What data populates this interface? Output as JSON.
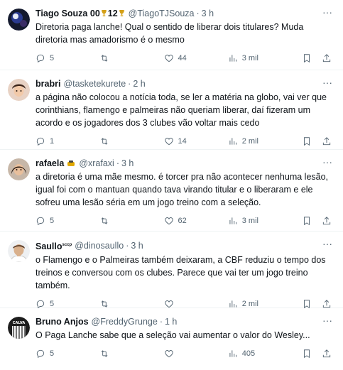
{
  "tweets": [
    {
      "name": "Tiago Souza 00",
      "badge_text": "12",
      "handle": "@TiagoTJSouza",
      "time": "3 h",
      "text": "Diretoria paga lanche! Qual o sentido de liberar dois titulares? Muda diretoria mas amadorismo é o mesmo",
      "replies": "5",
      "retweets": "",
      "likes": "44",
      "views": "3 mil"
    },
    {
      "name": "brabri",
      "handle": "@tasketekurete",
      "time": "2 h",
      "text": "a página não colocou a notícia toda, se ler a matéria na globo, vai ver que corinthians, flamengo e palmeiras não queriam liberar, daí fizeram um acordo e os jogadores dos 3 clubes vão voltar mais cedo",
      "replies": "1",
      "retweets": "",
      "likes": "14",
      "views": "2 mil"
    },
    {
      "name": "rafaela",
      "handle": "@xrafaxi",
      "time": "3 h",
      "text": "a diretoria é uma mãe mesmo. é torcer pra não acontecer nenhuma lesão, igual foi com o mantuan quando tava virando titular e o liberaram e ele sofreu uma lesão séria em um jogo treino com a seleção.",
      "replies": "5",
      "retweets": "",
      "likes": "62",
      "views": "3 mil"
    },
    {
      "name": "Saullo",
      "name_suffix": "sccp",
      "handle": "@dinosaullo",
      "time": "3 h",
      "text": "o Flamengo e o Palmeiras também deixaram, a CBF reduziu o tempo dos treinos e conversou com os clubes. Parece que vai ter um jogo treino também.",
      "replies": "5",
      "retweets": "",
      "likes": "",
      "views": "2 mil"
    },
    {
      "name": "Bruno Anjos",
      "handle": "@FreddyGrunge",
      "time": "1 h",
      "text": "O Paga Lanche sabe que a seleção vai aumentar o valor do Wesley...",
      "replies": "5",
      "retweets": "",
      "likes": "",
      "views": "405",
      "avatar_text": "CALVA"
    }
  ],
  "separator": "·",
  "colors": {
    "text": "#0f1419",
    "muted": "#536471",
    "divider": "#eff3f4",
    "trophy": "#d4a017"
  },
  "icons": [
    "reply-icon",
    "retweet-icon",
    "like-icon",
    "views-icon",
    "bookmark-icon",
    "share-icon",
    "more-icon",
    "trophy-icon"
  ]
}
